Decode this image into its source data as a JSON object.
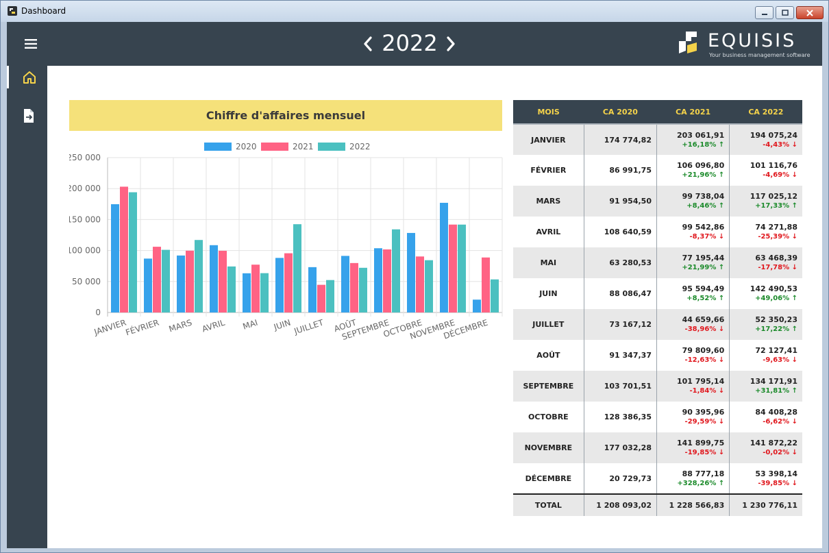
{
  "window": {
    "title": "Dashboard"
  },
  "icons": {
    "menu": "hamburger-icon",
    "home": "home-icon",
    "export": "file-export-icon",
    "prev": "chevron-left-icon",
    "next": "chevron-right-icon"
  },
  "colors": {
    "dark": "#37444f",
    "accent": "#f5e17a",
    "header_text": "#f5d34a",
    "up": "#1b8a2a",
    "down": "#e0161c"
  },
  "year_nav": {
    "year": "2022"
  },
  "logo": {
    "name": "EQUISIS",
    "tagline": "Your business management software"
  },
  "chart": {
    "title": "Chiffre d'affaires mensuel"
  },
  "chart_data": {
    "type": "bar",
    "categories": [
      "JANVIER",
      "FÉVRIER",
      "MARS",
      "AVRIL",
      "MAI",
      "JUIN",
      "JUILLET",
      "AOÛT",
      "SEPTEMBRE",
      "OCTOBRE",
      "NOVEMBRE",
      "DÉCEMBRE"
    ],
    "series": [
      {
        "name": "2020",
        "color": "#36a2eb",
        "values": [
          174774.82,
          86991.75,
          91954.5,
          108640.59,
          63280.53,
          88086.47,
          73167.12,
          91347.37,
          103701.51,
          128386.35,
          177032.28,
          20729.73
        ]
      },
      {
        "name": "2021",
        "color": "#ff6384",
        "values": [
          203061.91,
          106096.8,
          99738.04,
          99542.86,
          77195.44,
          95594.49,
          44659.66,
          79809.6,
          101795.14,
          90395.96,
          141899.75,
          88777.18
        ]
      },
      {
        "name": "2022",
        "color": "#4bc0c0",
        "values": [
          194075.24,
          101116.76,
          117025.12,
          74271.88,
          63468.39,
          142490.53,
          52350.23,
          72127.41,
          134171.91,
          84408.28,
          141872.22,
          53398.14
        ]
      }
    ],
    "yticks": [
      "0",
      "50 000",
      "100 000",
      "150 000",
      "200 000",
      "250 000"
    ],
    "ylim": [
      0,
      250000
    ],
    "legend": "top",
    "grid": true
  },
  "table": {
    "headers": [
      "MOIS",
      "CA 2020",
      "CA 2021",
      "CA 2022"
    ],
    "rows": [
      {
        "month": "JANVIER",
        "ca2020": "174 774,82",
        "ca2021": "203 061,91",
        "p2021": "+16,18%",
        "d2021": "up",
        "ca2022": "194 075,24",
        "p2022": "-4,43%",
        "d2022": "down"
      },
      {
        "month": "FÉVRIER",
        "ca2020": "86 991,75",
        "ca2021": "106 096,80",
        "p2021": "+21,96%",
        "d2021": "up",
        "ca2022": "101 116,76",
        "p2022": "-4,69%",
        "d2022": "down"
      },
      {
        "month": "MARS",
        "ca2020": "91 954,50",
        "ca2021": "99 738,04",
        "p2021": "+8,46%",
        "d2021": "up",
        "ca2022": "117 025,12",
        "p2022": "+17,33%",
        "d2022": "up"
      },
      {
        "month": "AVRIL",
        "ca2020": "108 640,59",
        "ca2021": "99 542,86",
        "p2021": "-8,37%",
        "d2021": "down",
        "ca2022": "74 271,88",
        "p2022": "-25,39%",
        "d2022": "down"
      },
      {
        "month": "MAI",
        "ca2020": "63 280,53",
        "ca2021": "77 195,44",
        "p2021": "+21,99%",
        "d2021": "up",
        "ca2022": "63 468,39",
        "p2022": "-17,78%",
        "d2022": "down"
      },
      {
        "month": "JUIN",
        "ca2020": "88 086,47",
        "ca2021": "95 594,49",
        "p2021": "+8,52%",
        "d2021": "up",
        "ca2022": "142 490,53",
        "p2022": "+49,06%",
        "d2022": "up"
      },
      {
        "month": "JUILLET",
        "ca2020": "73 167,12",
        "ca2021": "44 659,66",
        "p2021": "-38,96%",
        "d2021": "down",
        "ca2022": "52 350,23",
        "p2022": "+17,22%",
        "d2022": "up"
      },
      {
        "month": "AOÛT",
        "ca2020": "91 347,37",
        "ca2021": "79 809,60",
        "p2021": "-12,63%",
        "d2021": "down",
        "ca2022": "72 127,41",
        "p2022": "-9,63%",
        "d2022": "down"
      },
      {
        "month": "SEPTEMBRE",
        "ca2020": "103 701,51",
        "ca2021": "101 795,14",
        "p2021": "-1,84%",
        "d2021": "down",
        "ca2022": "134 171,91",
        "p2022": "+31,81%",
        "d2022": "up"
      },
      {
        "month": "OCTOBRE",
        "ca2020": "128 386,35",
        "ca2021": "90 395,96",
        "p2021": "-29,59%",
        "d2021": "down",
        "ca2022": "84 408,28",
        "p2022": "-6,62%",
        "d2022": "down"
      },
      {
        "month": "NOVEMBRE",
        "ca2020": "177 032,28",
        "ca2021": "141 899,75",
        "p2021": "-19,85%",
        "d2021": "down",
        "ca2022": "141 872,22",
        "p2022": "-0,02%",
        "d2022": "down"
      },
      {
        "month": "DÉCEMBRE",
        "ca2020": "20 729,73",
        "ca2021": "88 777,18",
        "p2021": "+328,26%",
        "d2021": "up",
        "ca2022": "53 398,14",
        "p2022": "-39,85%",
        "d2022": "down"
      }
    ],
    "total": {
      "label": "TOTAL",
      "ca2020": "1 208 093,02",
      "ca2021": "1 228 566,83",
      "ca2022": "1 230 776,11"
    }
  }
}
